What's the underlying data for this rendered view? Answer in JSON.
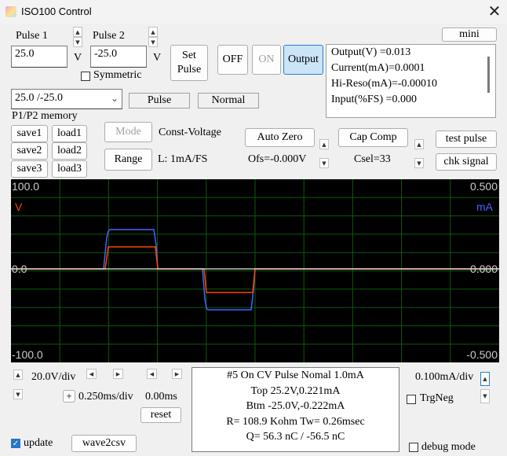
{
  "window": {
    "title": "ISO100 Control"
  },
  "pulse1": {
    "label": "Pulse 1",
    "value": "25.0",
    "unit": "V"
  },
  "pulse2": {
    "label": "Pulse 2",
    "value": "-25.0",
    "unit": "V"
  },
  "set_pulse_label": "Set\nPulse",
  "symmetric": {
    "label": "Symmetric",
    "checked": false
  },
  "preset": {
    "selected": "25.0 /-25.0"
  },
  "mode_status": {
    "pulse": "Pulse",
    "normal": "Normal"
  },
  "buttons": {
    "off": "OFF",
    "on": "ON",
    "output": "Output",
    "mini": "mini"
  },
  "readout": {
    "output_v": "Output(V)  =0.013",
    "current": "Current(mA)=0.0001",
    "hireso": "Hi-Reso(mA)=-0.00010",
    "input": "Input(%FS) =0.000"
  },
  "memory": {
    "title": "P1/P2 memory",
    "save1": "save1",
    "load1": "load1",
    "save2": "save2",
    "load2": "load2",
    "save3": "save3",
    "load3": "load3"
  },
  "mode": {
    "button": "Mode",
    "value": "Const-Voltage"
  },
  "range": {
    "button": "Range",
    "value": "L:  1mA/FS"
  },
  "auto_zero": {
    "button": "Auto Zero",
    "offset": "Ofs=-0.000V"
  },
  "cap_comp": {
    "button": "Cap Comp",
    "csel": "Csel=33"
  },
  "test_pulse": "test pulse",
  "chk_signal": "chk signal",
  "scope": {
    "y_left_top": "100.0",
    "y_left_mid": "0.0",
    "y_left_bottom": "-100.0",
    "y_right_top": "0.500",
    "y_right_mid": "0.000",
    "y_right_bottom": "-0.500",
    "left_unit": "V",
    "right_unit": "mA",
    "colors": {
      "background": "#000000",
      "grid": "#0c5a0c",
      "voltage": "#ff4400",
      "current": "#4466ff",
      "text": "#cccccc"
    }
  },
  "controls": {
    "vdiv": "20.0V/div",
    "plus": "+",
    "msdiv": "0.250ms/div",
    "offset_ms": "0.00ms",
    "reset": "reset",
    "madiv": "0.100mA/div",
    "trgneg": "TrgNeg",
    "update": "update",
    "wave2csv": "wave2csv",
    "debug": "debug mode"
  },
  "info": {
    "line1": "#5  On  CV Pulse Nomal 1.0mA",
    "line2": "Top 25.2V,0.221mA",
    "line3": "Btm -25.0V,-0.222mA",
    "line4": "R= 108.9 Kohm Tw= 0.26msec",
    "line5": "Q=  56.3 nC / -56.5 nC"
  }
}
